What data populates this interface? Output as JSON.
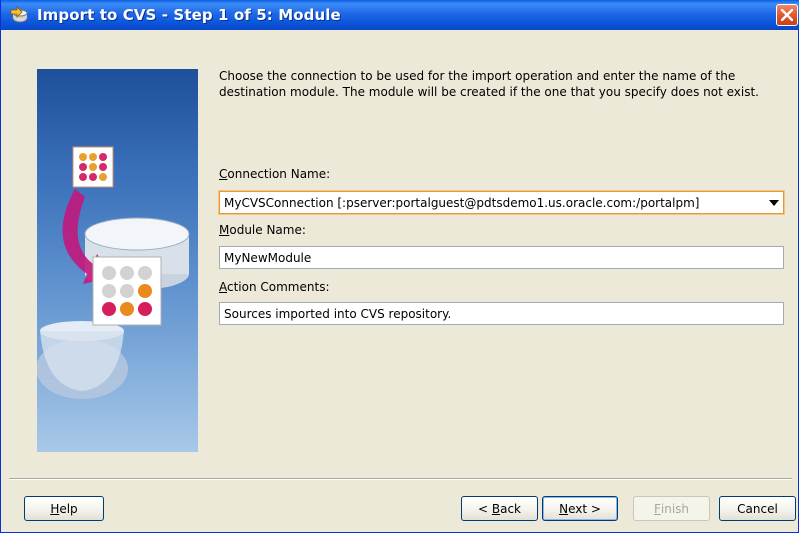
{
  "window": {
    "title": "Import to CVS - Step 1 of 5: Module"
  },
  "instructions": "Choose the connection to be used for the import operation and enter the name of the destination module. The module will be created if the one that you specify does not exist.",
  "fields": {
    "connection": {
      "label_mnemonic": "C",
      "label_rest": "onnection Name:",
      "value": "MyCVSConnection [:pserver:portalguest@pdtsdemo1.us.oracle.com:/portalpm]"
    },
    "module": {
      "label_mnemonic": "M",
      "label_rest": "odule Name:",
      "value": "MyNewModule"
    },
    "comments": {
      "label_mnemonic": "A",
      "label_rest": "ction Comments:",
      "value": "Sources imported into CVS repository."
    }
  },
  "buttons": {
    "help": {
      "mnemonic": "H",
      "rest": "elp"
    },
    "back": {
      "prefix": "< ",
      "mnemonic": "B",
      "rest": "ack"
    },
    "next": {
      "mnemonic": "N",
      "rest": "ext >"
    },
    "finish": {
      "mnemonic": "F",
      "rest": "inish"
    },
    "cancel": {
      "label": "Cancel"
    }
  },
  "colors": {
    "titlebar": "#0953d8",
    "close": "#e35b2e",
    "dialog_bg": "#ece9d8",
    "focus_border": "#e09a3f"
  },
  "icons": {
    "title": "cvs-import-icon",
    "close": "close-icon",
    "side": "wizard-illustration"
  }
}
